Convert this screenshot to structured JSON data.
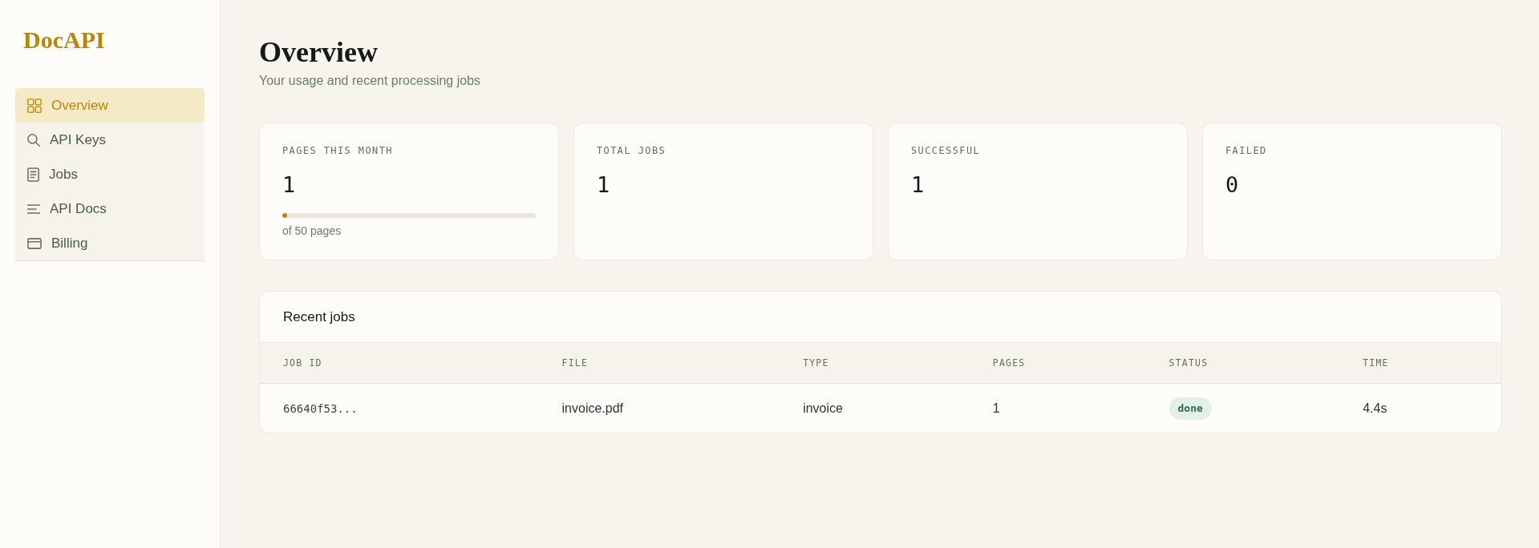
{
  "sidebar": {
    "logo": "DocAPI",
    "items": [
      {
        "label": "Overview",
        "selected": true
      },
      {
        "label": "API Keys",
        "selected": false
      },
      {
        "label": "Jobs",
        "selected": false
      },
      {
        "label": "API Docs",
        "selected": false
      },
      {
        "label": "Billing",
        "selected": false
      }
    ]
  },
  "header": {
    "title": "Overview",
    "subtitle": "Your usage and recent processing jobs"
  },
  "stats": [
    {
      "kind": "meter",
      "label": "PAGES THIS MONTH",
      "value": "1",
      "level": 0.02,
      "caption": "of 50 pages"
    },
    {
      "kind": "plain",
      "label": "TOTAL JOBS",
      "value": "1"
    },
    {
      "kind": "plain",
      "label": "SUCCESSFUL",
      "value": "1"
    },
    {
      "kind": "plain",
      "label": "FAILED",
      "value": "0"
    }
  ],
  "recent_jobs": {
    "title": "Recent jobs",
    "columns": [
      "JOB ID",
      "FILE",
      "TYPE",
      "PAGES",
      "STATUS",
      "TIME"
    ],
    "rows": [
      {
        "job_id": "66640f53...",
        "file": "invoice.pdf",
        "type": "invoice",
        "pages": "1",
        "status": "done",
        "time": "4.4s"
      }
    ]
  }
}
